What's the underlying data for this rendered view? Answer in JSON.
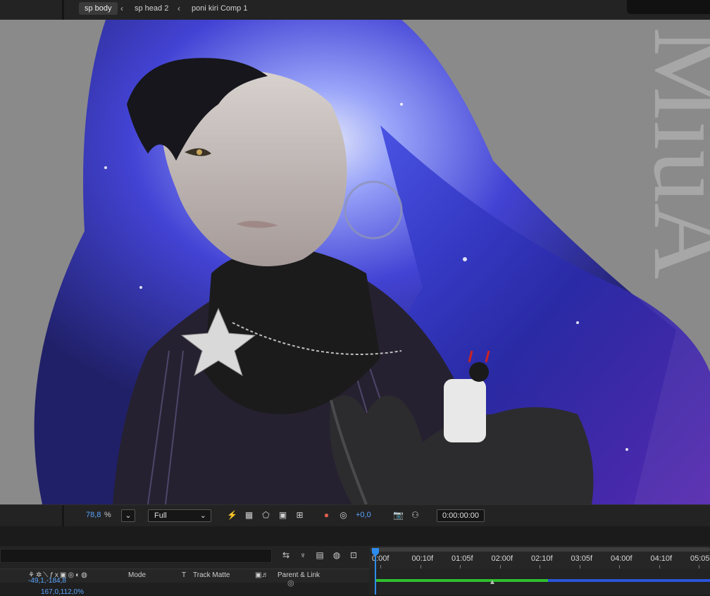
{
  "breadcrumbs": [
    "sp body",
    "sp head 2",
    "poni kiri Comp 1"
  ],
  "watermark": "MiuA",
  "viewer_toolbar": {
    "zoom_value": "78,8",
    "zoom_unit": "%",
    "resolution": "Full",
    "exposure": "+0,0",
    "current_time": "0:00:00:00"
  },
  "timeline": {
    "ruler_ticks": [
      "0:00f",
      "00:10f",
      "01:05f",
      "02:00f",
      "02:10f",
      "03:05f",
      "04:00f",
      "04:10f",
      "05:05f"
    ],
    "columns": {
      "mode": "Mode",
      "track_matte_t": "T",
      "track_matte": "Track Matte",
      "parent_link": "Parent & Link"
    },
    "property_values": [
      "-49,1,-184,8",
      "167,0,112,0%"
    ]
  },
  "colors": {
    "accent_blue": "#2d8ceb",
    "value_blue": "#5aa4ff",
    "work_area_green": "#2fbf2f",
    "viewer_bg": "#8a8a8a"
  }
}
